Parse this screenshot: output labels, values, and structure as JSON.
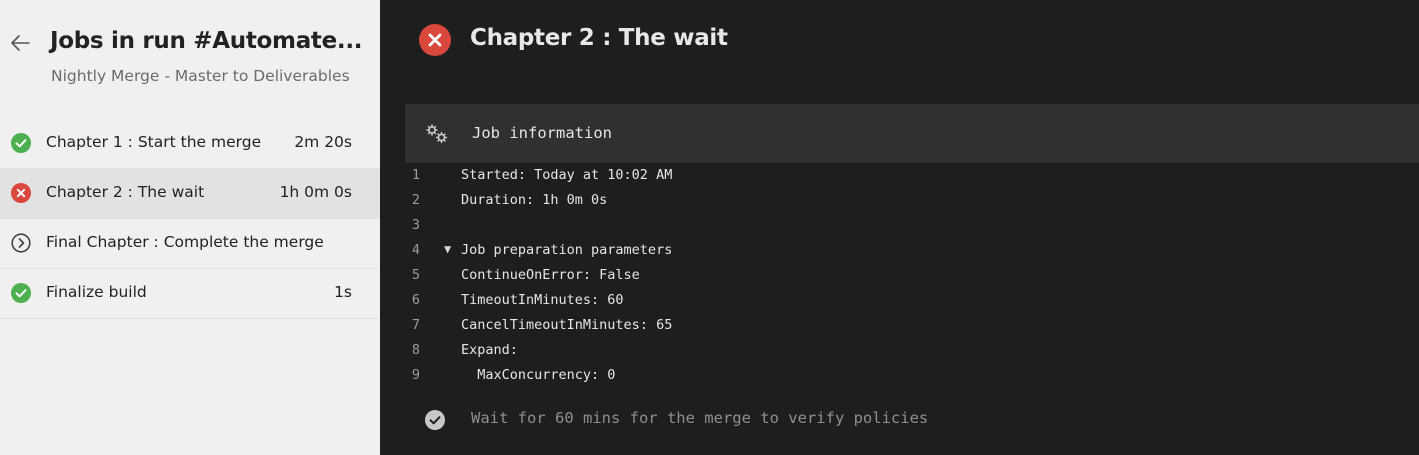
{
  "header": {
    "title": "Jobs in run #Automate...",
    "subtitle": "Nightly Merge - Master to Deliverables"
  },
  "jobs": [
    {
      "name": "Chapter 1 : Start the merge",
      "duration": "2m 20s",
      "status": "succeeded",
      "status_icon": "check-circle-icon",
      "selected": false
    },
    {
      "name": "Chapter 2 : The wait",
      "duration": "1h 0m 0s",
      "status": "failed",
      "status_icon": "x-circle-icon",
      "selected": true
    },
    {
      "name": "Final Chapter : Complete the merge",
      "duration": "",
      "status": "skipped",
      "status_icon": "chevron-circle-icon",
      "selected": false
    },
    {
      "name": "Finalize build",
      "duration": "1s",
      "status": "succeeded",
      "status_icon": "check-circle-icon",
      "selected": false
    }
  ],
  "detail": {
    "title": "Chapter 2 : The wait",
    "status": "failed",
    "job_info_label": "Job information",
    "log_lines": [
      {
        "num": "1",
        "text": "Started: Today at 10:02 AM"
      },
      {
        "num": "2",
        "text": "Duration: 1h 0m 0s"
      },
      {
        "num": "3",
        "text": ""
      },
      {
        "num": "4",
        "text": "Job preparation parameters",
        "collapsible": true
      },
      {
        "num": "5",
        "text": "ContinueOnError: False"
      },
      {
        "num": "6",
        "text": "TimeoutInMinutes: 60"
      },
      {
        "num": "7",
        "text": "CancelTimeoutInMinutes: 65"
      },
      {
        "num": "8",
        "text": "Expand:"
      },
      {
        "num": "9",
        "text": "  MaxConcurrency: 0"
      }
    ],
    "step_label": "Wait for 60 mins for the merge to verify policies"
  },
  "colors": {
    "success": "#4caf50",
    "failure": "#d9473d",
    "left_bg": "#f0f0f0",
    "right_bg": "#1e1e1e",
    "selected_bg": "#e2e2e2"
  },
  "icons": {
    "back": "arrow-left-icon",
    "job_info": "gear-icon",
    "step": "check-circle-icon"
  }
}
